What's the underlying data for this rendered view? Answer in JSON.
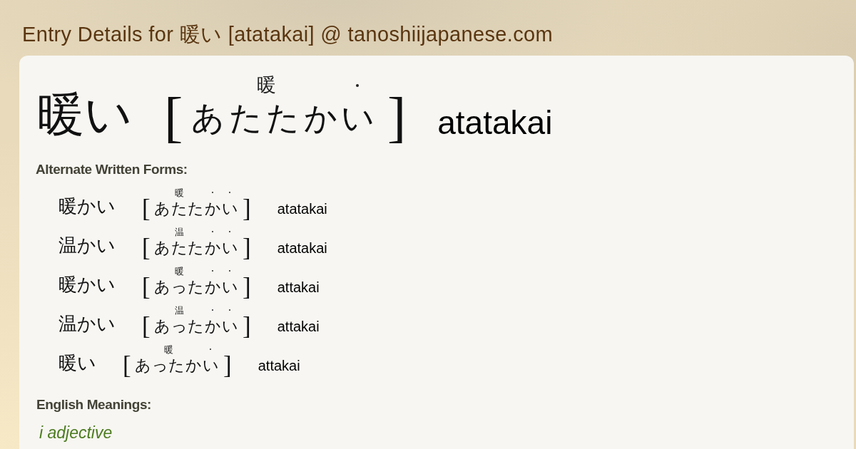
{
  "page_title": "Entry Details for 暖い [atatakai] @ tanoshiijapanese.com",
  "entry": {
    "written": "暖い",
    "reading": {
      "open": "[",
      "segments": [
        {
          "kana": "あたたか",
          "ruby": "暖",
          "dot": false
        },
        {
          "kana": "い",
          "dot": true
        }
      ],
      "close": "]"
    },
    "romaji": "atatakai"
  },
  "alternate_forms": {
    "heading": "Alternate Written Forms:",
    "items": [
      {
        "written": "暖かい",
        "reading": {
          "open": "[",
          "segments": [
            {
              "kana": "あたた",
              "ruby": "暖",
              "dot": false
            },
            {
              "kana": "か",
              "dot": true
            },
            {
              "kana": "い",
              "dot": true
            }
          ],
          "close": "]"
        },
        "romaji": "atatakai"
      },
      {
        "written": "温かい",
        "reading": {
          "open": "[",
          "segments": [
            {
              "kana": "あたた",
              "ruby": "温",
              "dot": false
            },
            {
              "kana": "か",
              "dot": true
            },
            {
              "kana": "い",
              "dot": true
            }
          ],
          "close": "]"
        },
        "romaji": "atatakai"
      },
      {
        "written": "暖かい",
        "reading": {
          "open": "[",
          "segments": [
            {
              "kana": "あった",
              "ruby": "暖",
              "dot": false
            },
            {
              "kana": "か",
              "dot": true
            },
            {
              "kana": "い",
              "dot": true
            }
          ],
          "close": "]"
        },
        "romaji": "attakai"
      },
      {
        "written": "温かい",
        "reading": {
          "open": "[",
          "segments": [
            {
              "kana": "あった",
              "ruby": "温",
              "dot": false
            },
            {
              "kana": "か",
              "dot": true
            },
            {
              "kana": "い",
              "dot": true
            }
          ],
          "close": "]"
        },
        "romaji": "attakai"
      },
      {
        "written": "暖い",
        "reading": {
          "open": "[",
          "segments": [
            {
              "kana": "あったか",
              "ruby": "暖",
              "dot": false
            },
            {
              "kana": "い",
              "dot": true
            }
          ],
          "close": "]"
        },
        "romaji": "attakai"
      }
    ]
  },
  "english_meanings": {
    "heading": "English Meanings:",
    "part_of_speech": "i adjective"
  }
}
